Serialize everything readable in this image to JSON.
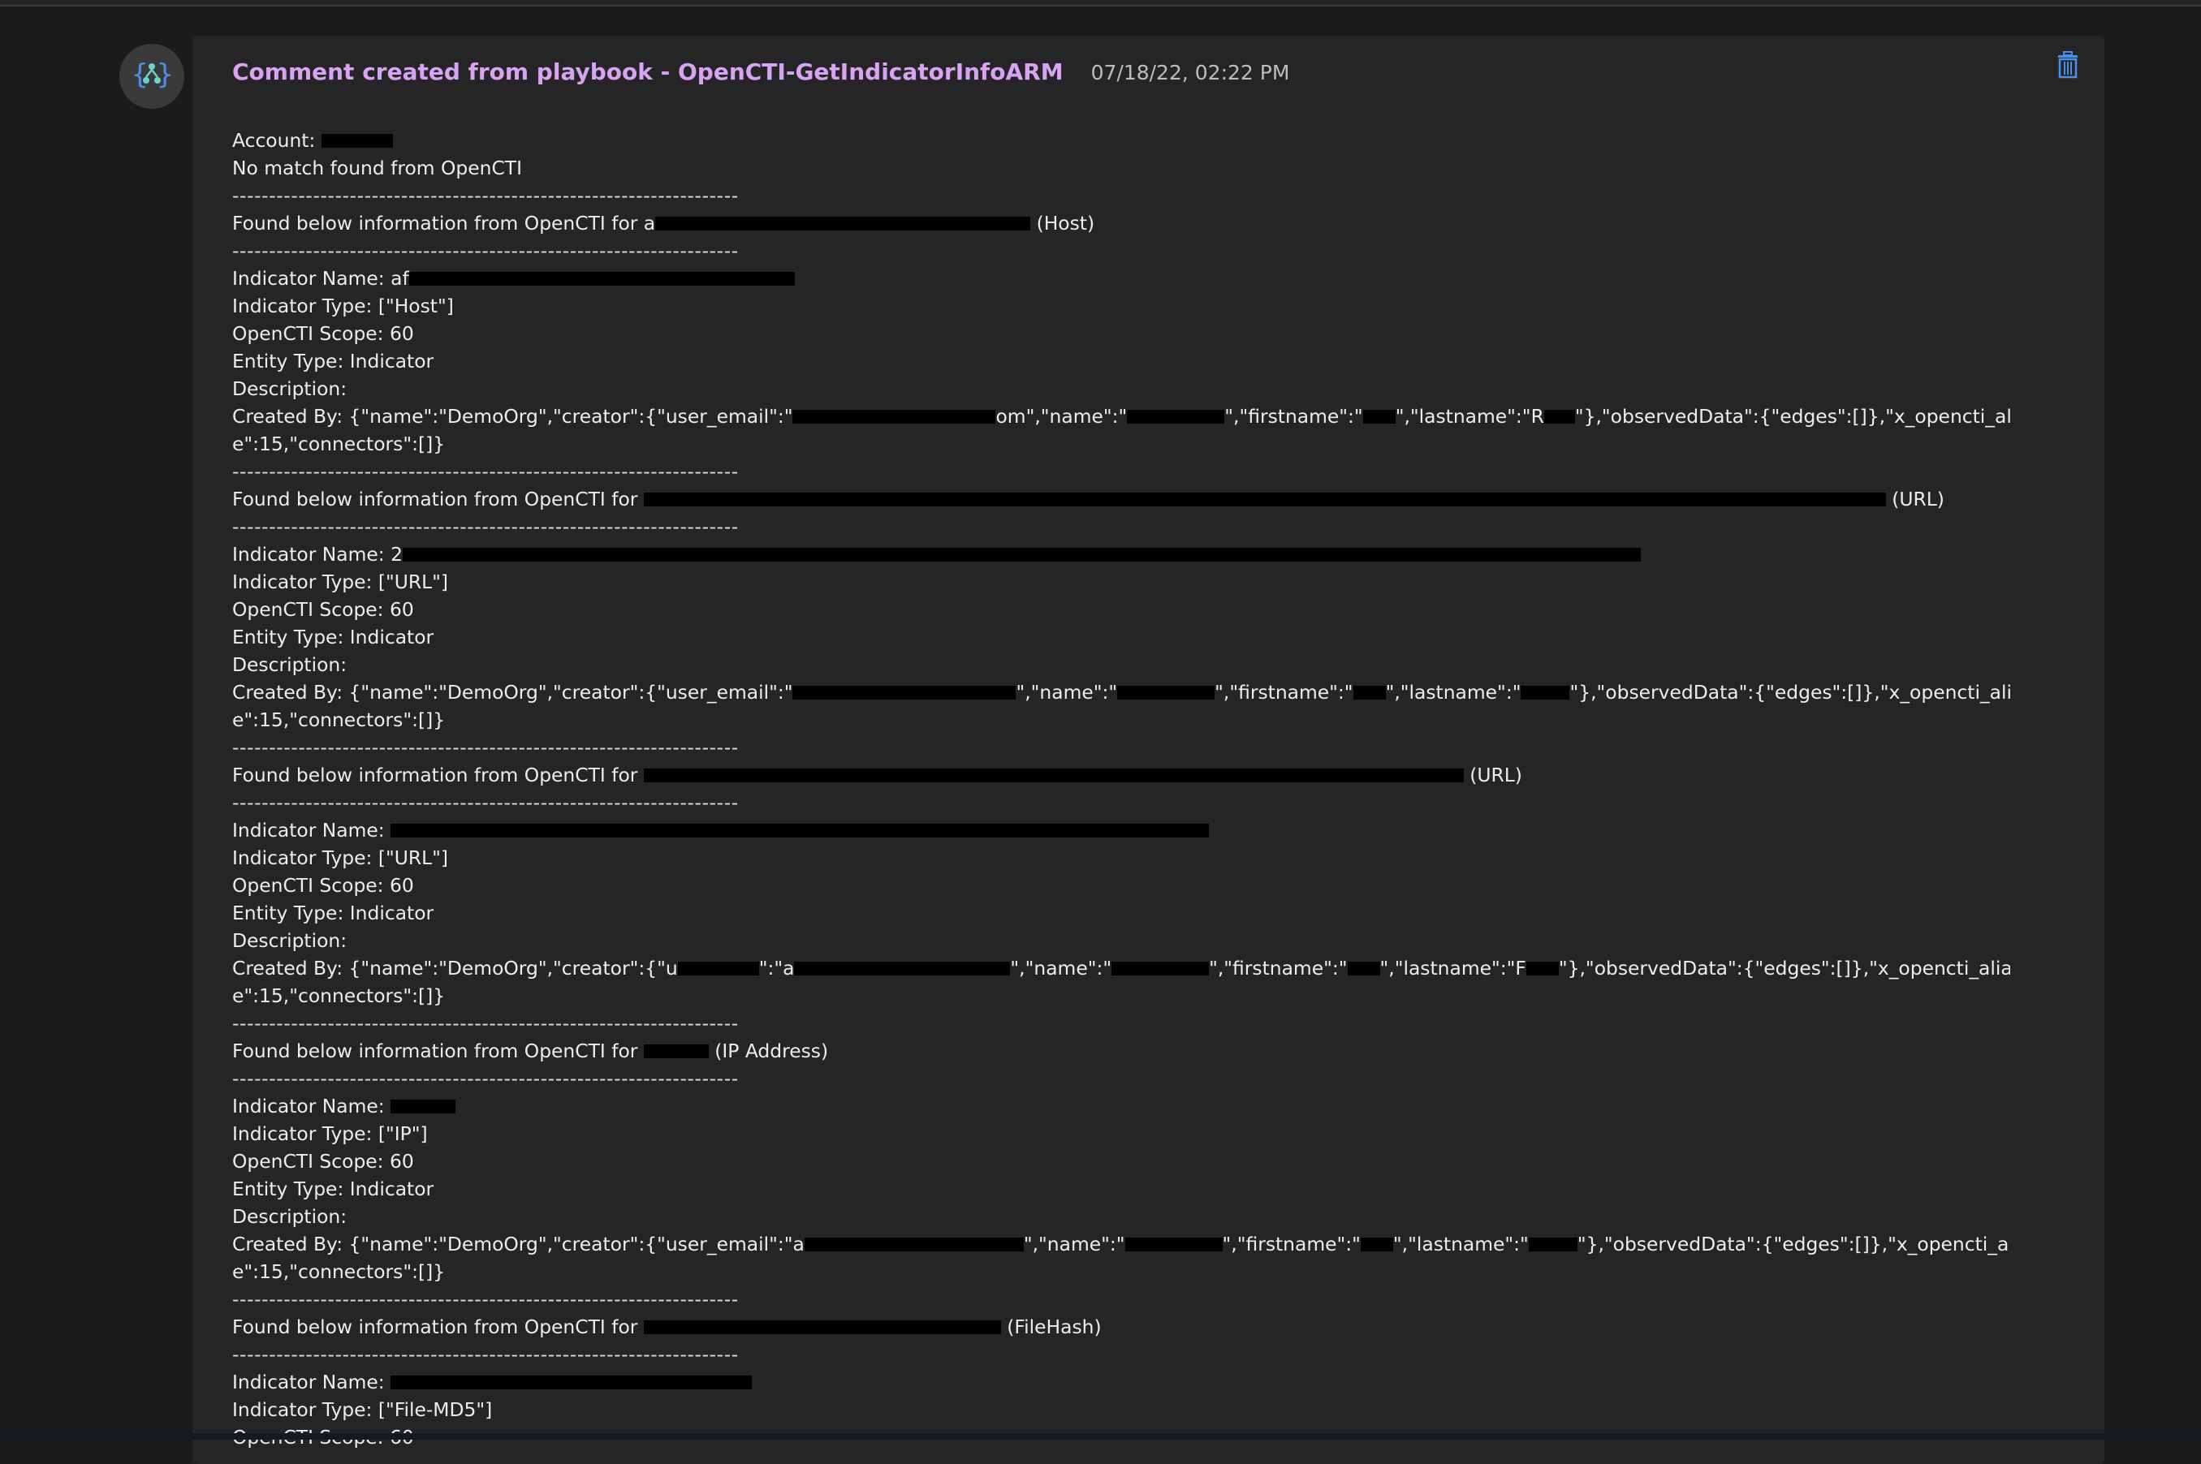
{
  "comment": {
    "title": "Comment created from playbook - OpenCTI-GetIndicatorInfoARM",
    "timestamp": "07/18/22, 02:22 PM",
    "avatar_icon": "logic-app-icon",
    "delete_icon": "trash-icon"
  },
  "colors": {
    "title": "#d7a3f2",
    "accent_icon": "#4a8fe8",
    "background": "#1b1b1b",
    "card": "#252525"
  },
  "separator": "---------------------------------------------------------------------",
  "lines": {
    "account": "Account:",
    "no_match": "No match found from OpenCTI",
    "found_prefix": "Found below information from OpenCTI for",
    "found_host_prefix": "Found below information from OpenCTI for a",
    "host_suffix": "(Host)",
    "url_suffix": "(URL)",
    "ip_suffix": "(IP Address)",
    "filehash_suffix": "(FileHash)",
    "indicator_name": "Indicator Name:",
    "indicator_name_af": "Indicator Name: af",
    "indicator_name_2": "Indicator Name: 2",
    "type_host": "Indicator Type: [\"Host\"]",
    "type_url": "Indicator Type: [\"URL\"]",
    "type_ip": "Indicator Type: [\"IP\"]",
    "type_md5": "Indicator Type: [\"File-MD5\"]",
    "scope": "OpenCTI Scope: 60",
    "scope_partial": "OpenCTI Scope: 60",
    "entity_type": "Entity Type: Indicator",
    "description": "Description:",
    "created_by_start": "Created By: {\"name\":\"DemoOrg\",\"creator\":{\"user_email\":\"",
    "created_by_start_u": "Created By: {\"name\":\"DemoOrg\",\"creator\":{\"u",
    "created_by_start_a": "Created By: {\"name\":\"DemoOrg\",\"creator\":{\"user_email\":\"a",
    "quote_a": "\":\"a",
    "om": "om",
    "name_key": "\",\"name\":\"",
    "firstname_key": "\",\"firstname\":\"",
    "lastname_key": "\",\"lastname\":\"",
    "lastname_key_r": "\",\"lastname\":\"R",
    "lastname_key_f": "\",\"lastname\":\"F",
    "observed_tail": "\"},\"observedData\":{\"edges\":[]},\"x_opencti_aliases\":null,\"confidenc",
    "connectors_tail": "e\":15,\"connectors\":[]}",
    "email_mid": "@"
  }
}
